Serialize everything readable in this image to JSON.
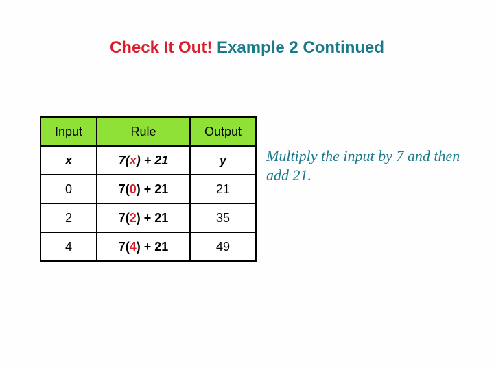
{
  "title": {
    "red": "Check It Out! ",
    "teal": "Example 2 Continued"
  },
  "headers": {
    "input": "Input",
    "rule": "Rule",
    "output": "Output"
  },
  "subhead": {
    "x": "x",
    "rule_pre": "7(",
    "rule_x": "x",
    "rule_post": ") + 21",
    "y": "y"
  },
  "rows": [
    {
      "in": "0",
      "pre": "7(",
      "xv": "0",
      "post": ") + 21",
      "out": "21"
    },
    {
      "in": "2",
      "pre": "7(",
      "xv": "2",
      "post": ") + 21",
      "out": "35"
    },
    {
      "in": "4",
      "pre": "7(",
      "xv": "4",
      "post": ") + 21",
      "out": "49"
    }
  ],
  "note": "Multiply the input by 7 and then add 21."
}
